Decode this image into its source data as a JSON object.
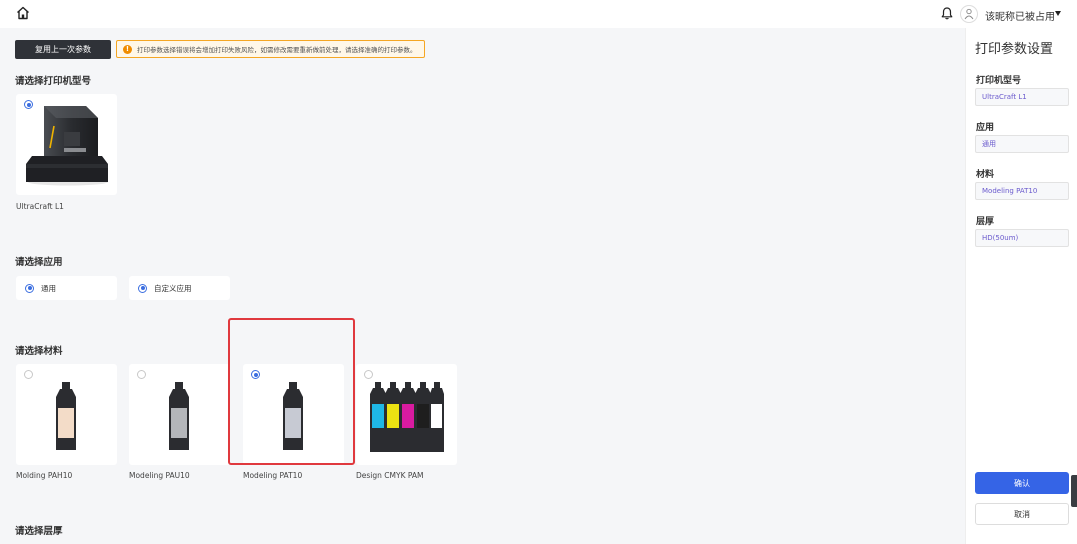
{
  "header": {
    "username": "该昵称已被占用",
    "icons": [
      "home-icon",
      "bell-icon",
      "avatar-icon",
      "caret-down-icon"
    ]
  },
  "toolbar": {
    "reuse_label": "复用上一次参数",
    "notice_text": "打印参数选择错误将会增加打印失败风险，如需修改需要重新做前处理，请选择准确的打印参数。"
  },
  "printer": {
    "title": "请选择打印机型号",
    "items": [
      {
        "name": "UltraCraft L1",
        "selected": true
      }
    ]
  },
  "application": {
    "title": "请选择应用",
    "items": [
      {
        "label": "通用",
        "selected": true
      },
      {
        "label": "自定义应用",
        "selected": true
      }
    ]
  },
  "material": {
    "title": "请选择材料",
    "items": [
      {
        "name": "Molding PAH10",
        "selected": false,
        "label_color": "#f3dcc8"
      },
      {
        "name": "Modeling PAU10",
        "selected": false,
        "label_color": "#b4b6ba"
      },
      {
        "name": "Modeling PAT10",
        "selected": true,
        "label_color": "#c7cad3"
      },
      {
        "name": "Design CMYK PAM",
        "selected": false,
        "label_colors": [
          "#1fb7e6",
          "#ece212",
          "#d91ba0",
          "#1e1e1e",
          "#ffffff"
        ]
      }
    ]
  },
  "layer": {
    "title": "请选择层厚"
  },
  "panel": {
    "title": "打印参数设置",
    "fields": [
      {
        "label": "打印机型号",
        "value": "UltraCraft L1"
      },
      {
        "label": "应用",
        "value": "通用"
      },
      {
        "label": "材料",
        "value": "Modeling PAT10"
      },
      {
        "label": "层厚",
        "value": "HD(50um)"
      }
    ],
    "confirm_label": "确认",
    "cancel_label": "取消"
  },
  "colors": {
    "primary": "#3564e6",
    "highlight": "#e0393e",
    "notice_border": "#f5a623",
    "dark_button": "#2f3238"
  }
}
